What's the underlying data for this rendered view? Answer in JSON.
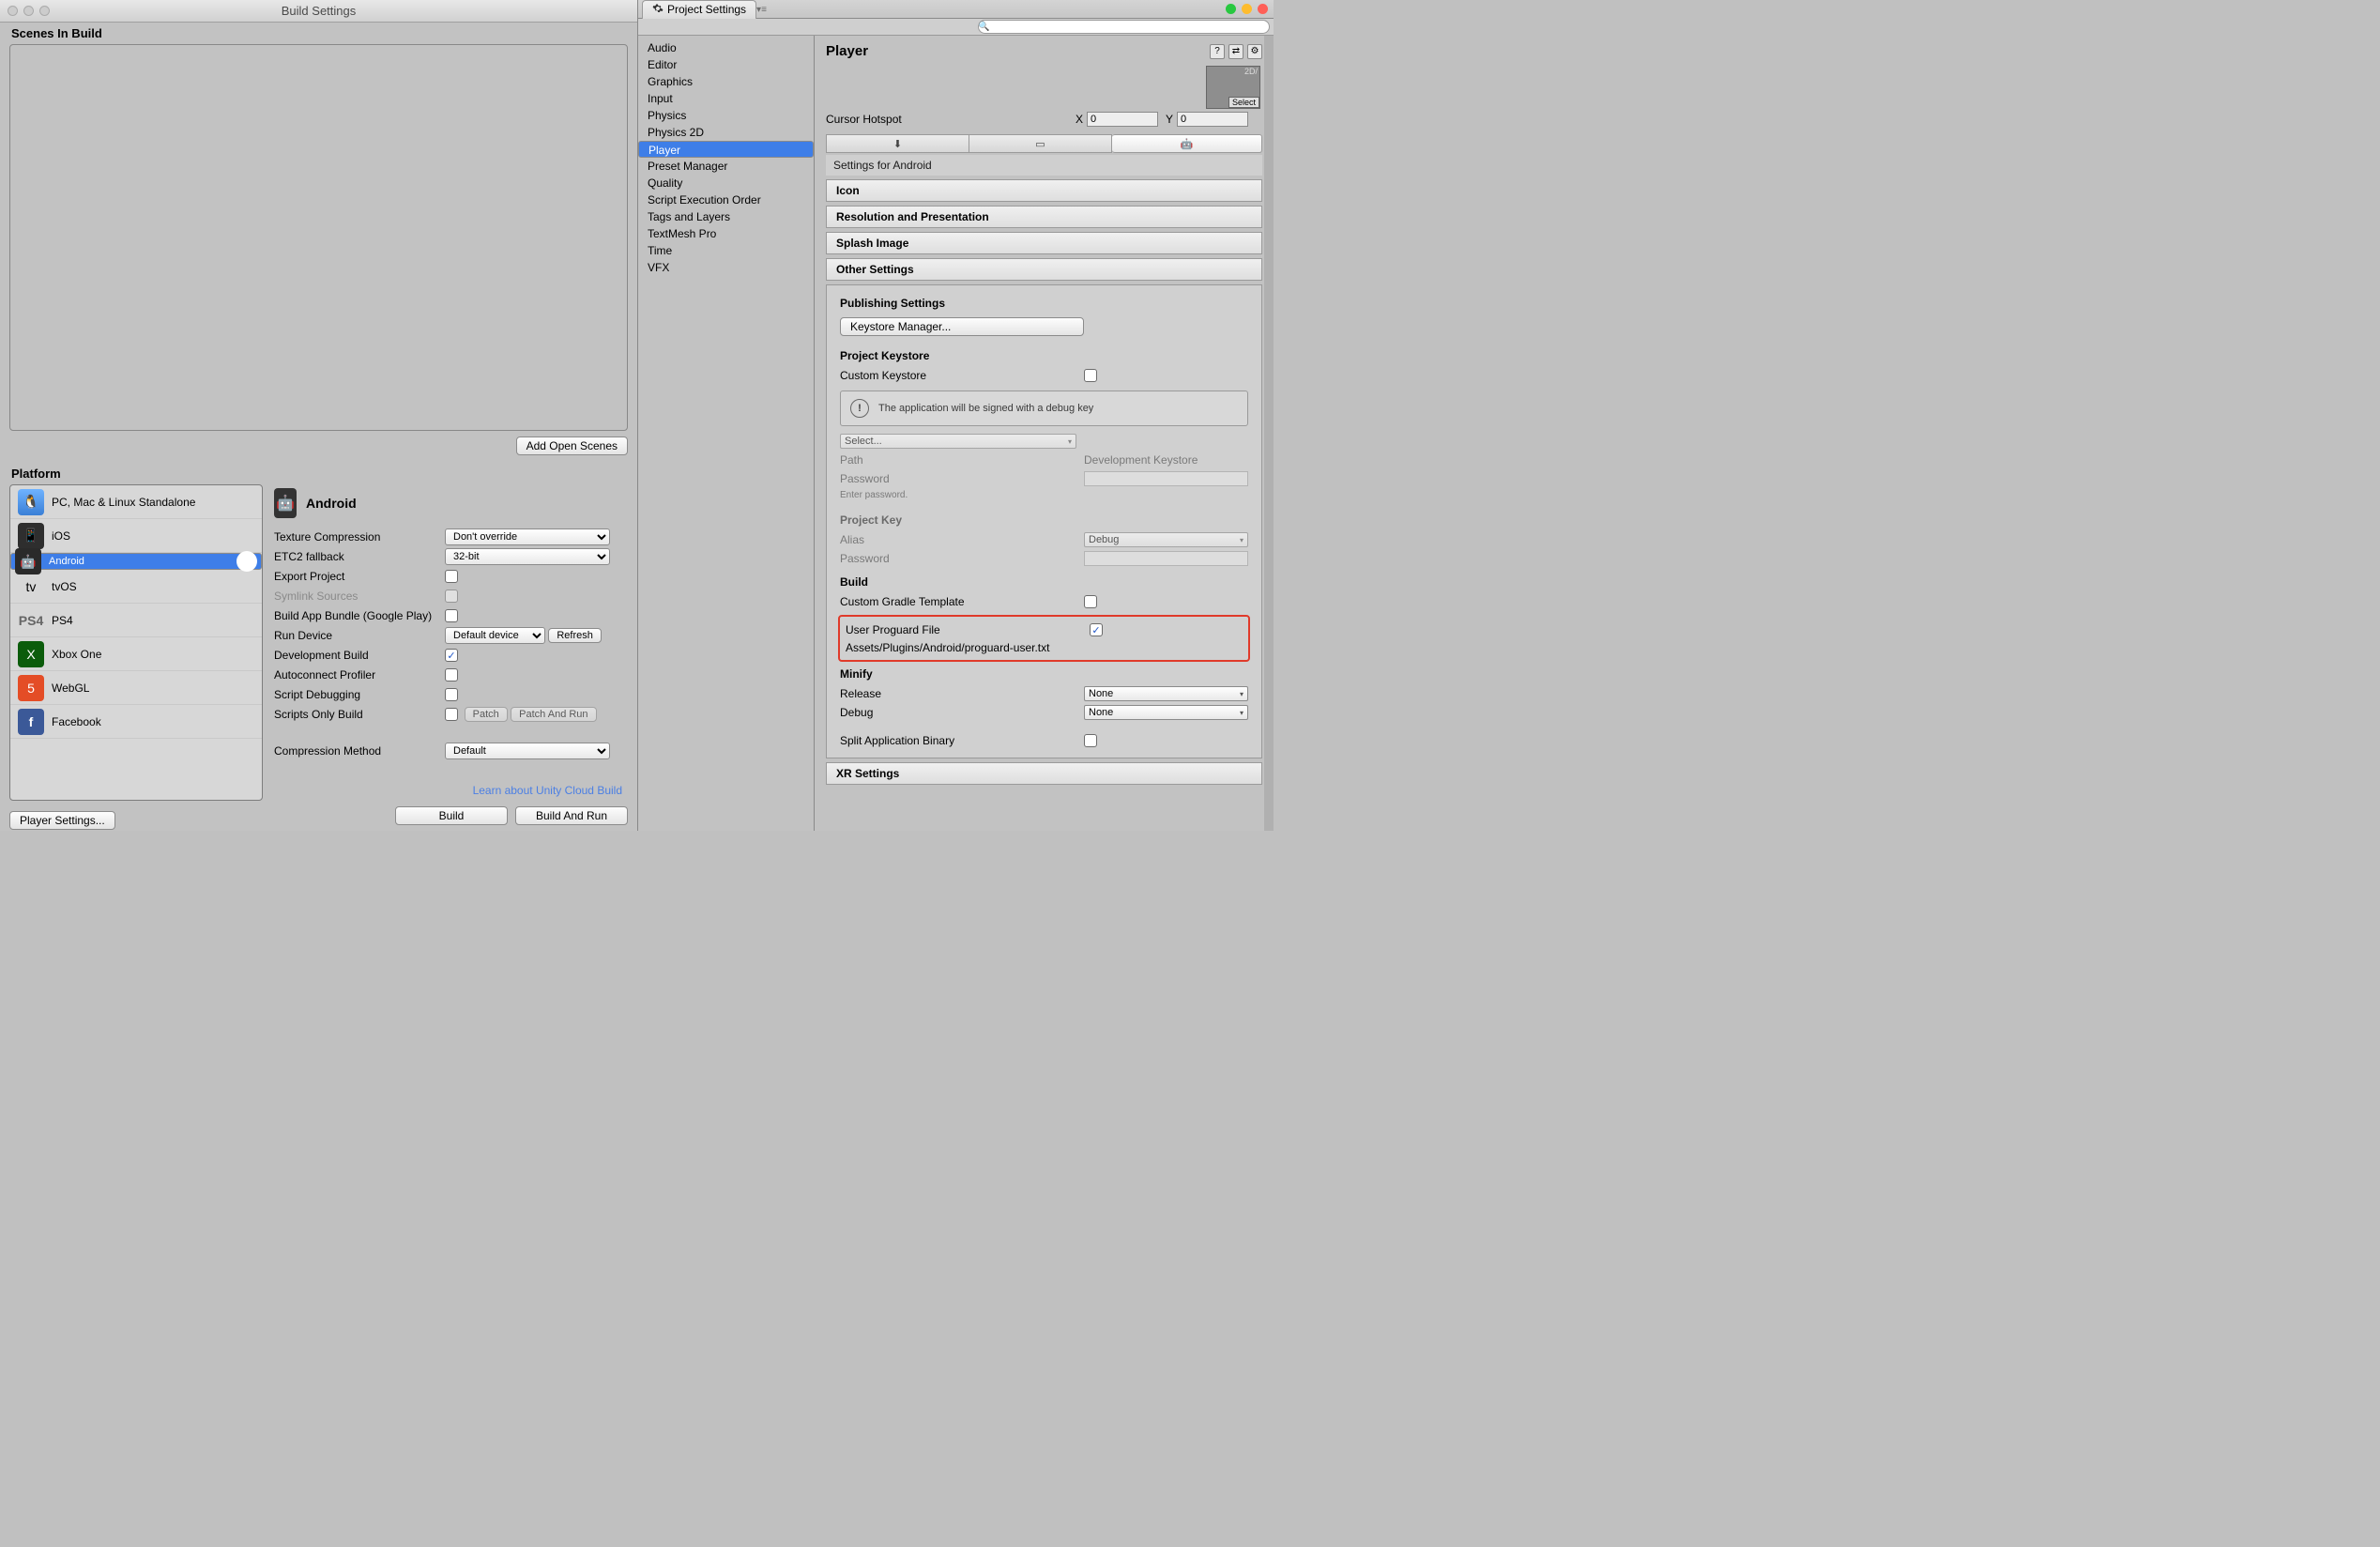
{
  "buildWindow": {
    "title": "Build Settings",
    "scenesLabel": "Scenes In Build",
    "addOpenScenes": "Add Open Scenes",
    "platformLabel": "Platform",
    "platforms": [
      "PC, Mac & Linux Standalone",
      "iOS",
      "Android",
      "tvOS",
      "PS4",
      "Xbox One",
      "WebGL",
      "Facebook"
    ],
    "androidTitle": "Android",
    "textureCompression": "Texture Compression",
    "textureCompressionVal": "Don't override",
    "etc2": "ETC2 fallback",
    "etc2Val": "32-bit",
    "exportProject": "Export Project",
    "symlink": "Symlink Sources",
    "buildAppBundle": "Build App Bundle (Google Play)",
    "runDevice": "Run Device",
    "runDeviceVal": "Default device",
    "refresh": "Refresh",
    "devBuild": "Development Build",
    "autoconnect": "Autoconnect Profiler",
    "scriptDebug": "Script Debugging",
    "scriptsOnly": "Scripts Only Build",
    "patch": "Patch",
    "patchAndRun": "Patch And Run",
    "compressionMethod": "Compression Method",
    "compressionVal": "Default",
    "learnLink": "Learn about Unity Cloud Build",
    "playerSettingsBtn": "Player Settings...",
    "buildBtn": "Build",
    "buildAndRun": "Build And Run"
  },
  "projectSettings": {
    "tabTitle": "Project Settings",
    "categories": [
      "Audio",
      "Editor",
      "Graphics",
      "Input",
      "Physics",
      "Physics 2D",
      "Player",
      "Preset Manager",
      "Quality",
      "Script Execution Order",
      "Tags and Layers",
      "TextMesh Pro",
      "Time",
      "VFX"
    ],
    "selectedCategory": "Player",
    "title": "Player",
    "selectLabel": "Select",
    "cursorHotspot": "Cursor Hotspot",
    "x": "X",
    "xv": "0",
    "y": "Y",
    "yv": "0",
    "settingsFor": "Settings for Android",
    "sections": {
      "icon": "Icon",
      "resolution": "Resolution and Presentation",
      "splash": "Splash Image",
      "other": "Other Settings",
      "publishing": "Publishing Settings",
      "xr": "XR Settings"
    },
    "keystoreManager": "Keystore Manager...",
    "projectKeystore": "Project Keystore",
    "customKeystore": "Custom Keystore",
    "debugKeyMsg": "The application will be signed with a debug key",
    "selectDots": "Select...",
    "pathLbl": "Path",
    "pathVal": "Development Keystore",
    "passwordLbl": "Password",
    "passwordHint": "Enter password.",
    "projectKey": "Project Key",
    "aliasLbl": "Alias",
    "aliasVal": "Debug",
    "buildHead": "Build",
    "customGradle": "Custom Gradle Template",
    "userProguard": "User Proguard File",
    "proguardPath": "Assets/Plugins/Android/proguard-user.txt",
    "minify": "Minify",
    "release": "Release",
    "debugLbl": "Debug",
    "none": "None",
    "splitAppBinary": "Split Application Binary",
    "iconLabel2d": "2D/"
  }
}
